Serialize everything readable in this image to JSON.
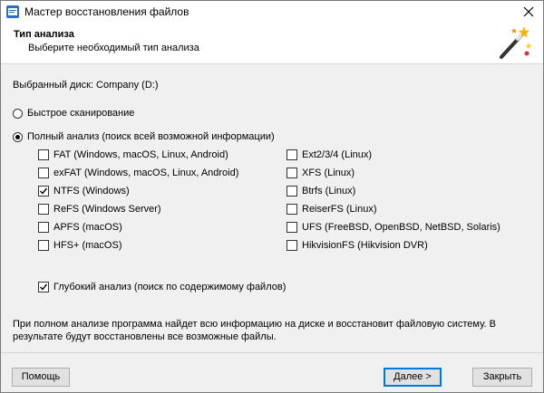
{
  "window": {
    "title": "Мастер восстановления файлов"
  },
  "header": {
    "title": "Тип анализа",
    "subtitle": "Выберите необходимый тип анализа"
  },
  "disk": {
    "label": "Выбранный диск: Company (D:)"
  },
  "scan_modes": [
    {
      "label": "Быстрое сканирование",
      "selected": false
    },
    {
      "label": "Полный анализ (поиск всей возможной информации)",
      "selected": true
    }
  ],
  "filesystems": {
    "left": [
      {
        "label": "FAT (Windows, macOS, Linux, Android)",
        "checked": false
      },
      {
        "label": "exFAT (Windows, macOS, Linux, Android)",
        "checked": false
      },
      {
        "label": "NTFS (Windows)",
        "checked": true
      },
      {
        "label": "ReFS (Windows Server)",
        "checked": false
      },
      {
        "label": "APFS (macOS)",
        "checked": false
      },
      {
        "label": "HFS+ (macOS)",
        "checked": false
      }
    ],
    "right": [
      {
        "label": "Ext2/3/4 (Linux)",
        "checked": false
      },
      {
        "label": "XFS (Linux)",
        "checked": false
      },
      {
        "label": "Btrfs (Linux)",
        "checked": false
      },
      {
        "label": "ReiserFS (Linux)",
        "checked": false
      },
      {
        "label": "UFS (FreeBSD, OpenBSD, NetBSD, Solaris)",
        "checked": false
      },
      {
        "label": "HikvisionFS (Hikvision DVR)",
        "checked": false
      }
    ]
  },
  "deep_analysis": {
    "label": "Глубокий анализ (поиск по содержимому файлов)",
    "checked": true
  },
  "info": {
    "text": "При полном анализе программа найдет всю информацию на диске и восстановит файловую систему. В результате будут восстановлены все возможные файлы."
  },
  "buttons": {
    "help": "Помощь",
    "next": "Далее >",
    "close": "Закрыть"
  }
}
